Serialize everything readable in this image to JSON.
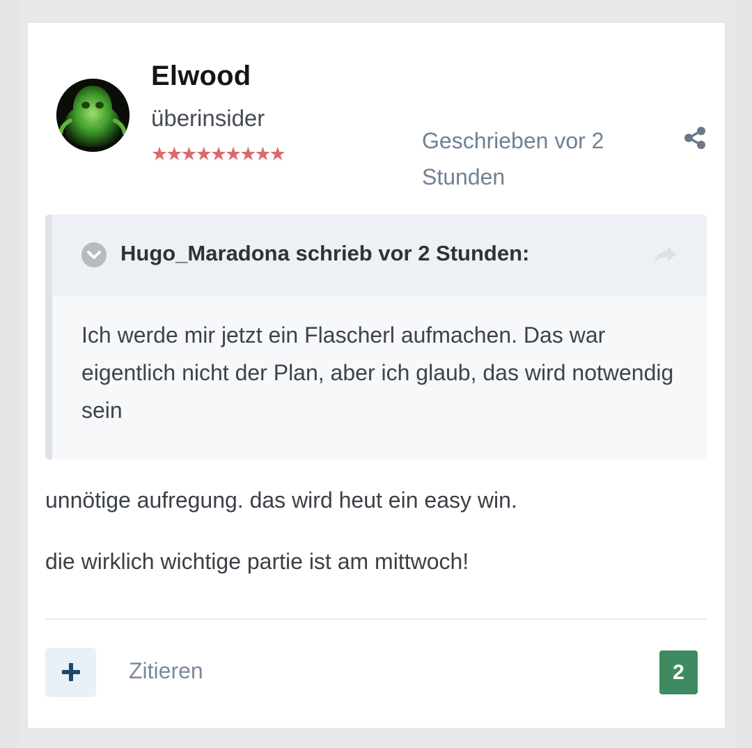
{
  "author": {
    "name": "Elwood",
    "rank": "überinsider",
    "stars": "★★★★★★★★★",
    "avatar_icon": "ghost-avatar"
  },
  "post": {
    "posted_time": "Geschrieben vor 2 Stunden",
    "paragraphs": [
      "unnötige aufregung. das wird heut ein easy win.",
      "die wirklich wichtige partie ist am mittwoch!"
    ]
  },
  "quote": {
    "citation": "Hugo_Maradona schrieb vor 2 Stunden:",
    "text": "Ich werde mir jetzt ein Flascherl aufmachen. Das war eigentlich nicht der Plan, aber ich glaub, das wird notwendig sein",
    "toggle_icon": "chevron-down-icon",
    "jump_icon": "share-arrow-icon"
  },
  "actions": {
    "react_icon": "plus-icon",
    "quote_label": "Zitieren",
    "reaction_count": "2",
    "share_icon": "share-icon"
  },
  "colors": {
    "accent": "#6f8194",
    "reaction_badge": "#3f8b61",
    "stars": "#dc6a6a",
    "react_button_bg": "#e8f0f8"
  }
}
